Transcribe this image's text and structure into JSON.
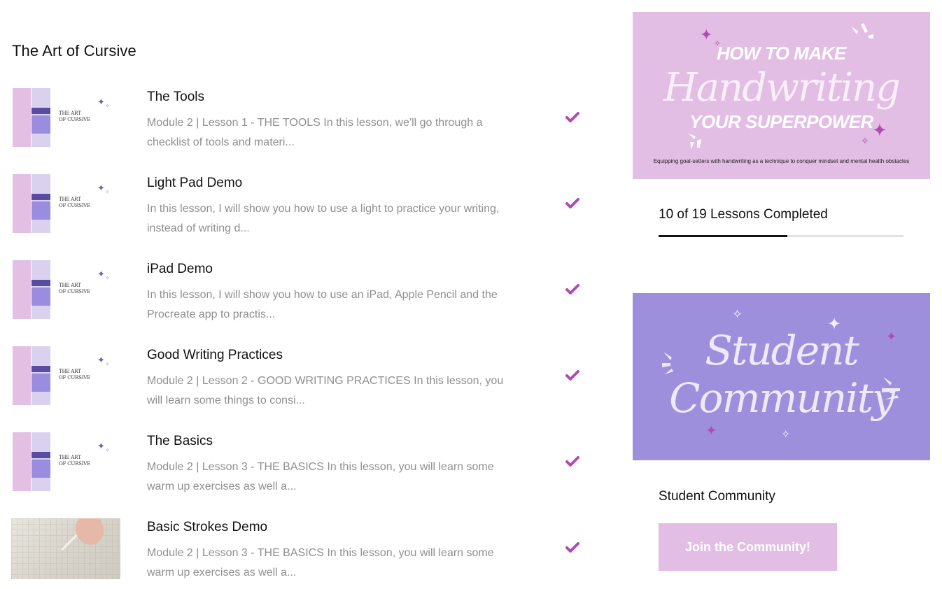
{
  "course": {
    "title": "The Art of Cursive"
  },
  "lessons": [
    {
      "title": "The Tools",
      "description": "Module 2 | Lesson 1 - THE TOOLS In this lesson, we'll go through a checklist of tools and materi...",
      "completed": true,
      "thumbnail": "the-art-of-cursive-cover",
      "thumb_text": "THE ART\nOF CURSIVE"
    },
    {
      "title": "Light Pad Demo",
      "description": "In this lesson, I will show you how to use a light to practice your writing, instead of writing d...",
      "completed": true,
      "thumbnail": "the-art-of-cursive-cover",
      "thumb_text": "THE ART\nOF CURSIVE"
    },
    {
      "title": "iPad Demo",
      "description": "In this lesson, I will show you how to use an iPad, Apple Pencil and the Procreate app to practis...",
      "completed": true,
      "thumbnail": "the-art-of-cursive-cover",
      "thumb_text": "THE ART\nOF CURSIVE"
    },
    {
      "title": "Good Writing Practices",
      "description": "Module 2 | Lesson 2 - GOOD WRITING PRACTICES In this lesson, you will learn some things to consi...",
      "completed": true,
      "thumbnail": "the-art-of-cursive-cover",
      "thumb_text": "THE ART\nOF CURSIVE"
    },
    {
      "title": "The Basics",
      "description": "Module 2 | Lesson 3 - THE BASICS In this lesson, you will learn some warm up exercises as well a...",
      "completed": true,
      "thumbnail": "the-art-of-cursive-cover",
      "thumb_text": "THE ART\nOF CURSIVE"
    },
    {
      "title": "Basic Strokes Demo",
      "description": "Module 2 | Lesson 3 - THE BASICS In this lesson, you will learn some warm up exercises as well a...",
      "completed": true,
      "thumbnail": "hand-writing-photo"
    }
  ],
  "promo": {
    "line1": "HOW TO MAKE",
    "line2": "Handwriting",
    "line3": "YOUR SUPERPOWER",
    "tagline": "Equipping goal-setters with handwriting as a technique to conquer mindset and mental health obstacles"
  },
  "progress": {
    "label": "10 of 19 Lessons Completed",
    "completed": 10,
    "total": 19
  },
  "community": {
    "banner_line1": "Student",
    "banner_line2": "Community",
    "title": "Student Community",
    "button_label": "Join the Community!"
  },
  "icons": {
    "check": "checkmark-icon",
    "sparkle": "sparkle-icon"
  },
  "colors": {
    "accent": "#b14bb2",
    "pink": "#e2bde4",
    "lavender": "#9d8fdc",
    "text_muted": "#8f8f8f"
  }
}
